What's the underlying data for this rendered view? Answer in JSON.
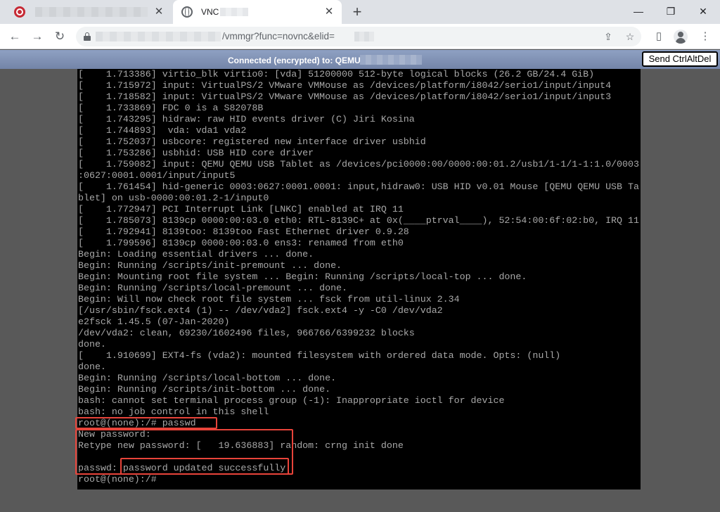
{
  "browser": {
    "tabs": [
      {
        "title": ""
      },
      {
        "title": "VNC"
      }
    ],
    "address": {
      "url_visible": "/vmmgr?func=novnc&elid="
    }
  },
  "vnc": {
    "status": "Connected (encrypted) to: QEMU",
    "send_cad_label": "Send CtrlAltDel"
  },
  "console": {
    "lines": [
      "[    1.713386] virtio_blk virtio0: [vda] 51200000 512-byte logical blocks (26.2 GB/24.4 GiB)",
      "[    1.715972] input: VirtualPS/2 VMware VMMouse as /devices/platform/i8042/serio1/input/input4",
      "[    1.718582] input: VirtualPS/2 VMware VMMouse as /devices/platform/i8042/serio1/input/input3",
      "[    1.733869] FDC 0 is a S82078B",
      "[    1.743295] hidraw: raw HID events driver (C) Jiri Kosina",
      "[    1.744893]  vda: vda1 vda2",
      "[    1.752037] usbcore: registered new interface driver usbhid",
      "[    1.753286] usbhid: USB HID core driver",
      "[    1.759082] input: QEMU QEMU USB Tablet as /devices/pci0000:00/0000:00:01.2/usb1/1-1/1-1:1.0/0003",
      ":0627:0001.0001/input/input5",
      "[    1.761454] hid-generic 0003:0627:0001.0001: input,hidraw0: USB HID v0.01 Mouse [QEMU QEMU USB Ta",
      "blet] on usb-0000:00:01.2-1/input0",
      "[    1.772947] PCI Interrupt Link [LNKC] enabled at IRQ 11",
      "[    1.785073] 8139cp 0000:00:03.0 eth0: RTL-8139C+ at 0x(____ptrval____), 52:54:00:6f:02:b0, IRQ 11",
      "[    1.792941] 8139too: 8139too Fast Ethernet driver 0.9.28",
      "[    1.799596] 8139cp 0000:00:03.0 ens3: renamed from eth0",
      "Begin: Loading essential drivers ... done.",
      "Begin: Running /scripts/init-premount ... done.",
      "Begin: Mounting root file system ... Begin: Running /scripts/local-top ... done.",
      "Begin: Running /scripts/local-premount ... done.",
      "Begin: Will now check root file system ... fsck from util-linux 2.34",
      "[/usr/sbin/fsck.ext4 (1) -- /dev/vda2] fsck.ext4 -y -C0 /dev/vda2",
      "e2fsck 1.45.5 (07-Jan-2020)",
      "/dev/vda2: clean, 69230/1602496 files, 966766/6399232 blocks",
      "done.",
      "[    1.910699] EXT4-fs (vda2): mounted filesystem with ordered data mode. Opts: (null)",
      "done.",
      "Begin: Running /scripts/local-bottom ... done.",
      "Begin: Running /scripts/init-bottom ... done.",
      "bash: cannot set terminal process group (-1): Inappropriate ioctl for device",
      "bash: no job control in this shell",
      "root@(none):/# passwd",
      "New password:",
      "Retype new password: [   19.636883] random: crng init done",
      "",
      "passwd: password updated successfully",
      "root@(none):/#"
    ]
  }
}
